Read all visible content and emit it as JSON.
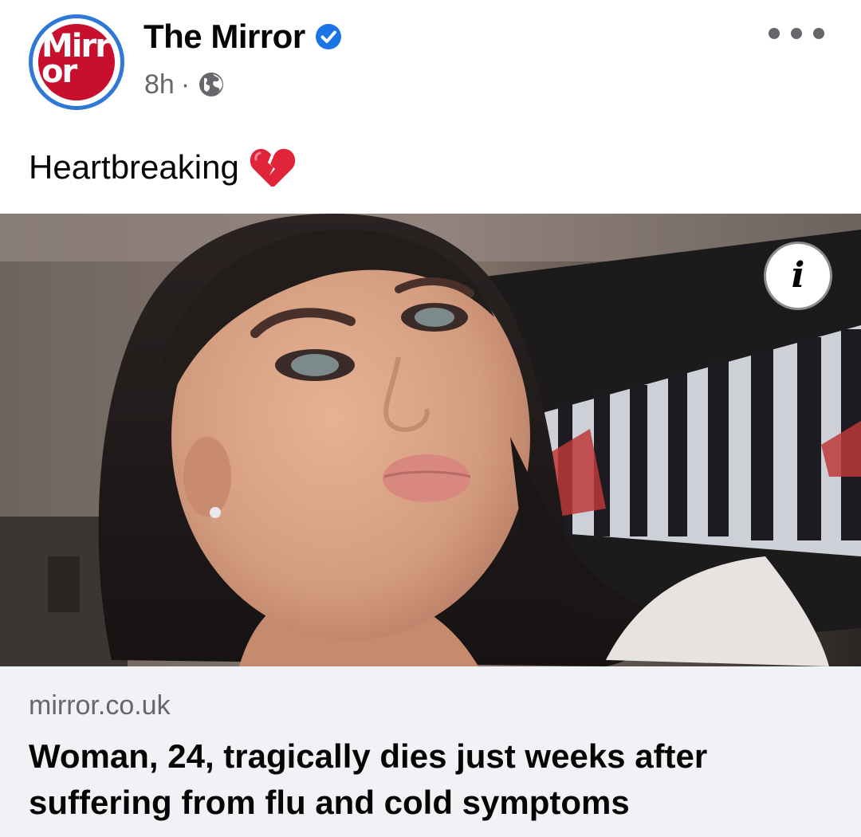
{
  "post": {
    "page_name": "The Mirror",
    "verified": true,
    "timestamp": "8h",
    "separator": "·",
    "audience_icon": "globe-icon",
    "message": "Heartbreaking",
    "message_emoji": "broken-heart-icon",
    "avatar_logo": {
      "line1": "Mirr",
      "line2": "or"
    }
  },
  "link_preview": {
    "domain": "mirror.co.uk",
    "title": "Woman, 24, tragically dies just weeks after suffering from flu and cold symptoms"
  },
  "icons": {
    "more": "more-dots-icon",
    "info": "info-icon",
    "verified": "verified-badge-icon"
  },
  "colors": {
    "verified_blue": "#1b74e4",
    "mirror_red": "#c8102e",
    "avatar_ring": "#2f78d6",
    "secondary_text": "#65676b",
    "preview_bg": "#f0f2f5"
  }
}
